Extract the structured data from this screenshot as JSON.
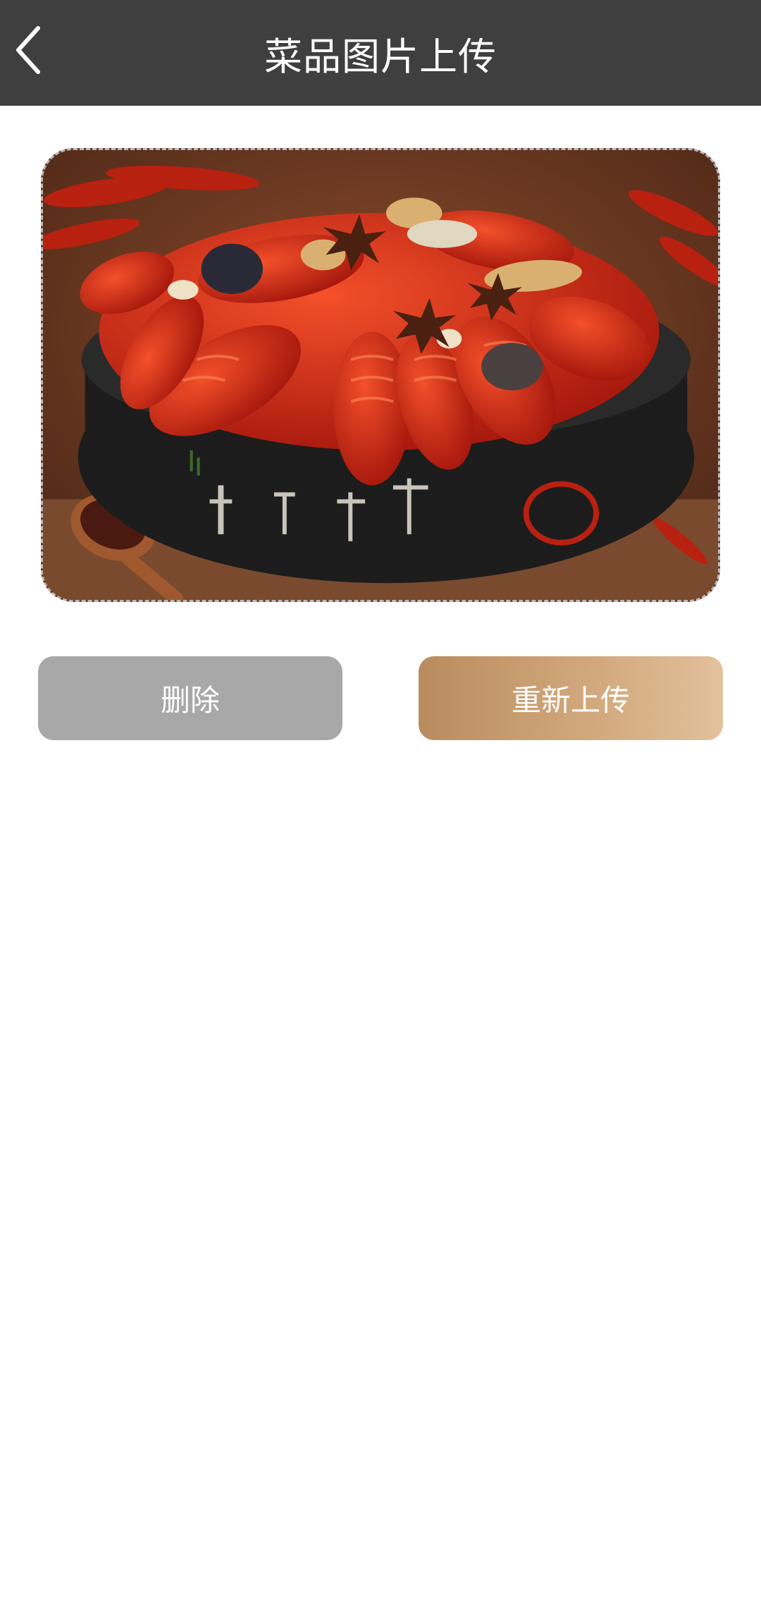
{
  "header": {
    "title": "菜品图片上传",
    "back_icon": "chevron-left-icon",
    "background": "#3f3f3f"
  },
  "photo": {
    "description_icon": "crawfish-dish-image",
    "border_style": "dashed"
  },
  "actions": {
    "delete_label": "删除",
    "reupload_label": "重新上传",
    "delete_color": "#a8a8a8",
    "reupload_color_start": "#b98c5f",
    "reupload_color_end": "#e2c19d"
  }
}
